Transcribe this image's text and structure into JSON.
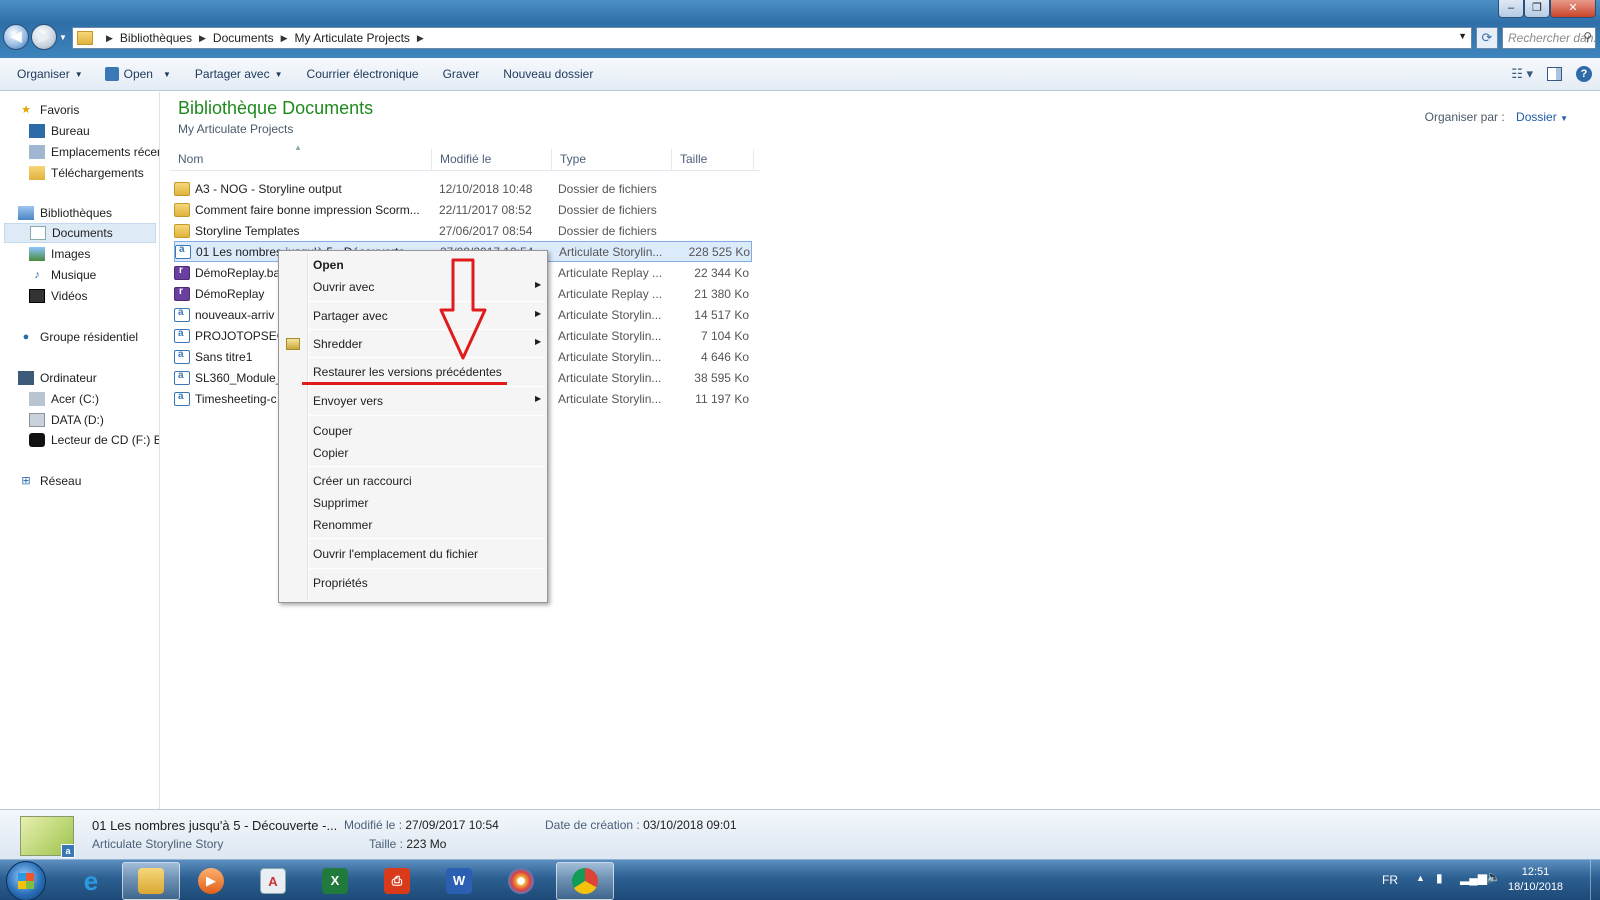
{
  "window": {
    "controls": [
      "–",
      "❐",
      "✕"
    ]
  },
  "address_bar": {
    "crumbs": [
      "Bibliothèques",
      "Documents",
      "My Articulate Projects"
    ],
    "search_placeholder": "Rechercher dan..."
  },
  "toolbar": {
    "organize": "Organiser",
    "open": "Open",
    "share": "Partager avec",
    "email": "Courrier électronique",
    "burn": "Graver",
    "new_folder": "Nouveau dossier"
  },
  "sidebar": {
    "favorites": "Favoris",
    "desktop": "Bureau",
    "recent": "Emplacements récents",
    "downloads": "Téléchargements",
    "libraries": "Bibliothèques",
    "documents": "Documents",
    "images": "Images",
    "music": "Musique",
    "videos": "Vidéos",
    "homegroup": "Groupe résidentiel",
    "computer": "Ordinateur",
    "drive_c": "Acer (C:)",
    "drive_d": "DATA (D:)",
    "drive_f": "Lecteur de CD (F:) BD",
    "network": "Réseau"
  },
  "library": {
    "title": "Bibliothèque Documents",
    "subtitle": "My Articulate Projects",
    "arrange_label": "Organiser par :",
    "arrange_value": "Dossier"
  },
  "columns": {
    "name": "Nom",
    "modified": "Modifié le",
    "type": "Type",
    "size": "Taille"
  },
  "files": [
    {
      "name": "A3 - NOG - Storyline output",
      "modified": "12/10/2018 10:48",
      "type": "Dossier de fichiers",
      "size": "",
      "kind": "folder"
    },
    {
      "name": "Comment faire bonne impression Scorm...",
      "modified": "22/11/2017 08:52",
      "type": "Dossier de fichiers",
      "size": "",
      "kind": "folder"
    },
    {
      "name": "Storyline Templates",
      "modified": "27/06/2017 08:54",
      "type": "Dossier de fichiers",
      "size": "",
      "kind": "folder"
    },
    {
      "name": "01  Les nombres jusqu'à 5 - Découverte",
      "modified": "27/09/2017 10:54",
      "type": "Articulate Storylin...",
      "size": "228 525 Ko",
      "kind": "story"
    },
    {
      "name": "DémoReplay.ba",
      "modified": "",
      "type": "Articulate Replay ...",
      "size": "22 344 Ko",
      "kind": "replay"
    },
    {
      "name": "DémoReplay",
      "modified": "",
      "type": "Articulate Replay ...",
      "size": "21 380 Ko",
      "kind": "replay"
    },
    {
      "name": "nouveaux-arriv",
      "modified": "",
      "type": "Articulate Storylin...",
      "size": "14 517 Ko",
      "kind": "story"
    },
    {
      "name": "PROJOTOPSEC",
      "modified": "",
      "type": "Articulate Storylin...",
      "size": "7 104 Ko",
      "kind": "story"
    },
    {
      "name": "Sans titre1",
      "modified": "",
      "type": "Articulate Storylin...",
      "size": "4 646 Ko",
      "kind": "story"
    },
    {
      "name": "SL360_Module_",
      "modified": "",
      "type": "Articulate Storylin...",
      "size": "38 595 Ko",
      "kind": "story"
    },
    {
      "name": "Timesheeting-c",
      "modified": "",
      "type": "Articulate Storylin...",
      "size": "11 197 Ko",
      "kind": "story"
    }
  ],
  "context_menu": {
    "open": "Open",
    "open_with": "Ouvrir avec",
    "share_with": "Partager avec",
    "shredder": "Shredder",
    "restore": "Restaurer les versions précédentes",
    "send_to": "Envoyer vers",
    "cut": "Couper",
    "copy": "Copier",
    "shortcut": "Créer un raccourci",
    "delete": "Supprimer",
    "rename": "Renommer",
    "open_location": "Ouvrir l'emplacement du fichier",
    "properties": "Propriétés"
  },
  "details": {
    "name": "01  Les nombres jusqu'à 5 - Découverte -...",
    "type": "Articulate Storyline Story",
    "modified_label": "Modifié le :",
    "modified": "27/09/2017 10:54",
    "size_label": "Taille :",
    "size": "223 Mo",
    "created_label": "Date de création :",
    "created": "03/10/2018 09:01"
  },
  "taskbar": {
    "lang": "FR",
    "time": "12:51",
    "date": "18/10/2018"
  },
  "colors": {
    "title_green": "#1e8a1e",
    "accent_blue": "#1e5aa8",
    "annotation_red": "#e01b1b"
  }
}
